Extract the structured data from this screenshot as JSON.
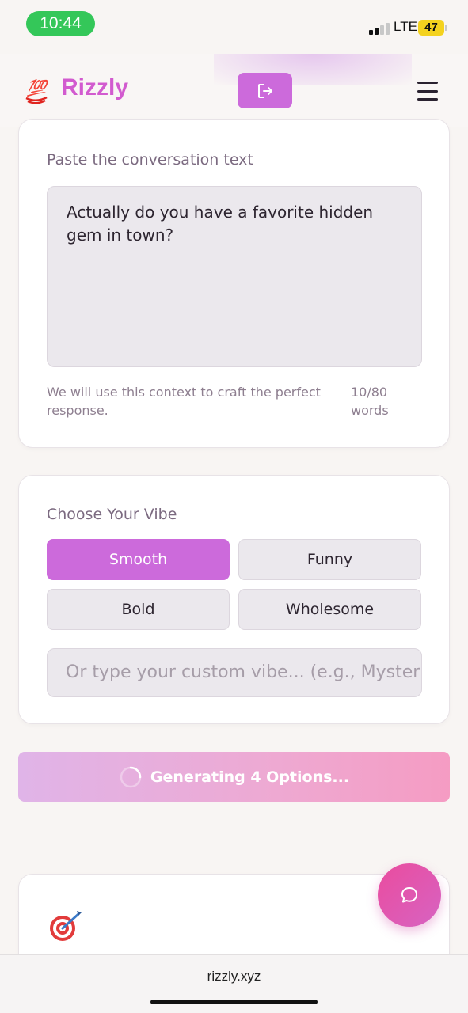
{
  "status_bar": {
    "time": "10:44",
    "network": "LTE",
    "battery": "47"
  },
  "header": {
    "logo_emoji": "💯",
    "app_name": "Rizzly",
    "logout_icon": "logout-icon",
    "menu_icon": "hamburger-menu-icon"
  },
  "conversation": {
    "label": "Paste the conversation text",
    "text": "Actually do you have a favorite hidden gem in town?",
    "helper": "We will use this context to craft the perfect response.",
    "word_count": "10/80 words"
  },
  "vibe": {
    "label": "Choose Your Vibe",
    "options": [
      {
        "label": "Smooth",
        "selected": true
      },
      {
        "label": "Funny",
        "selected": false
      },
      {
        "label": "Bold",
        "selected": false
      },
      {
        "label": "Wholesome",
        "selected": false
      }
    ],
    "custom_placeholder": "Or type your custom vibe... (e.g., Mysterious)"
  },
  "generate": {
    "label": "Generating 4 Options..."
  },
  "results": {
    "emoji": "🎯"
  },
  "chat_icon": "chat-bubble-icon",
  "browser": {
    "url": "rizzly.xyz"
  },
  "colors": {
    "accent": "#cc6adb",
    "brand_text": "#d25bcf",
    "fab_gradient_start": "#ea4c9e",
    "fab_gradient_end": "#d763c2",
    "generate_gradient_start": "#e0b4e8",
    "generate_gradient_end": "#f59cc3"
  }
}
